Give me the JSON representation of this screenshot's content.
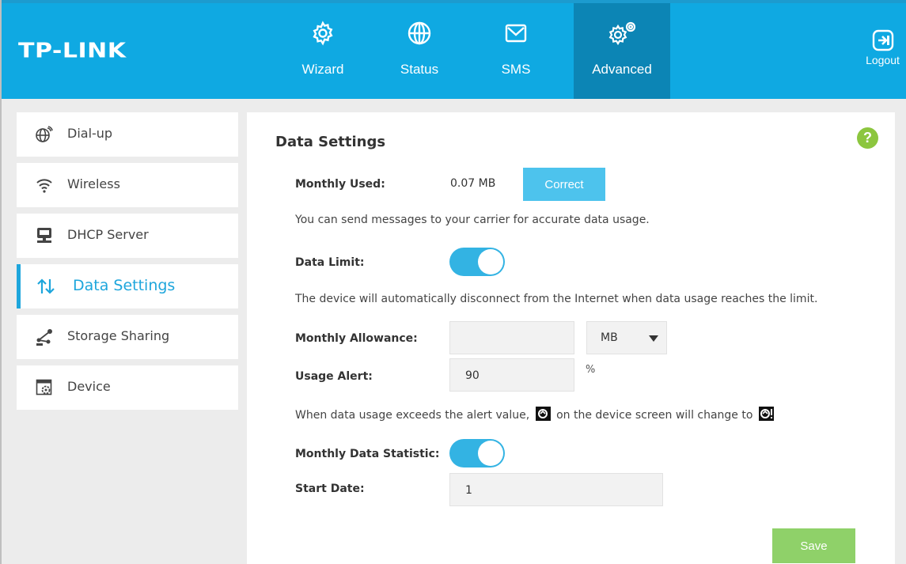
{
  "brand": {
    "logo": "TP-LINK",
    "header_color": "#0fa9e2",
    "active_nav_color": "#0c85b5"
  },
  "nav": [
    {
      "label": "Wizard",
      "icon": "gear-icon"
    },
    {
      "label": "Status",
      "icon": "globe-icon"
    },
    {
      "label": "SMS",
      "icon": "envelope-icon"
    },
    {
      "label": "Advanced",
      "icon": "gears-icon",
      "active": true
    }
  ],
  "logout": {
    "label": "Logout",
    "icon": "logout-icon"
  },
  "sidebar": {
    "items": [
      {
        "label": "Dial-up",
        "icon": "globe-signal-icon"
      },
      {
        "label": "Wireless",
        "icon": "wifi-icon"
      },
      {
        "label": "DHCP Server",
        "icon": "server-icon"
      },
      {
        "label": "Data Settings",
        "icon": "up-down-arrows-icon",
        "active": true
      },
      {
        "label": "Storage Sharing",
        "icon": "share-icon"
      },
      {
        "label": "Device",
        "icon": "device-settings-icon"
      }
    ]
  },
  "main": {
    "title": "Data Settings",
    "help_icon": "?",
    "monthly_used": {
      "label": "Monthly Used:",
      "value": "0.07 MB",
      "button": "Correct"
    },
    "carrier_note": "You can send messages to your carrier for accurate data usage.",
    "data_limit": {
      "label": "Data Limit:",
      "enabled": true
    },
    "limit_note": "The device will automatically disconnect from the Internet when data usage reaches the limit.",
    "monthly_allowance": {
      "label": "Monthly Allowance:",
      "value": "",
      "unit_selected": "MB"
    },
    "usage_alert": {
      "label": "Usage Alert:",
      "value": "90",
      "unit": "%"
    },
    "alert_note_part1": "When data usage exceeds the alert value,",
    "alert_note_part2": "on the device screen will change to",
    "monthly_statistic": {
      "label": "Monthly Data Statistic:",
      "enabled": true
    },
    "start_date": {
      "label": "Start Date:",
      "value": "1"
    },
    "save_label": "Save"
  }
}
